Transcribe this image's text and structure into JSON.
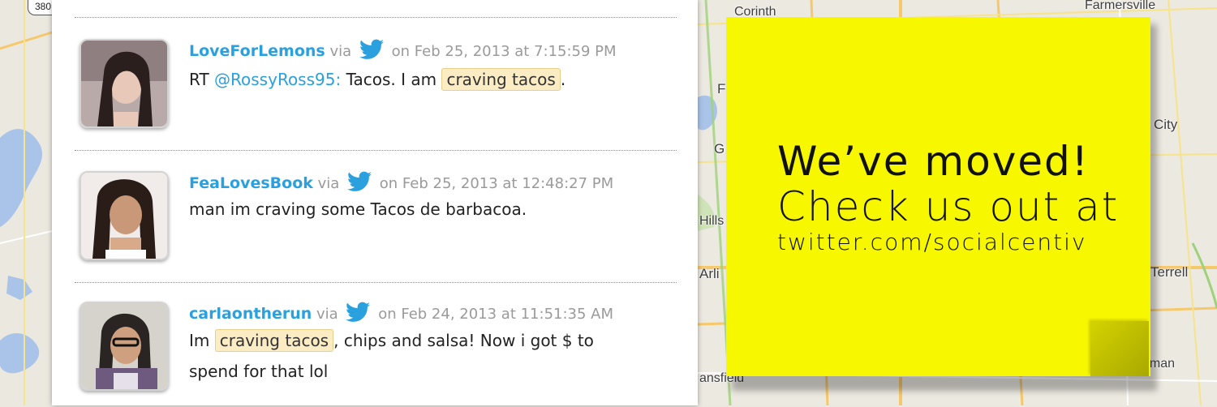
{
  "map": {
    "shield": "380",
    "labels": [
      "Corinth",
      "Farmersville",
      "City",
      "Terrell",
      "Kaufman",
      "Arli",
      "Hills",
      "G",
      "F",
      "ansfield"
    ]
  },
  "tweets": [
    {
      "username": "LoveForLemons",
      "via": "via",
      "date": "on Feb 25, 2013 at 7:15:59 PM",
      "text_rt": "RT",
      "mention": "@RossyRoss95:",
      "text_before": "Tacos. I am",
      "highlight": "craving tacos",
      "text_after": "."
    },
    {
      "username": "FeaLovesBook",
      "via": "via",
      "date": "on Feb 25, 2013 at 12:48:27 PM",
      "text": "man im craving some Tacos de barbacoa."
    },
    {
      "username": "carlaontherun",
      "via": "via",
      "date": "on Feb 24, 2013 at 11:51:35 AM",
      "text_before": "Im",
      "highlight": "craving tacos",
      "text_after": ", chips and salsa! Now i got $ to",
      "text_line2": "spend for that lol"
    }
  ],
  "note": {
    "line1": "We’ve moved!",
    "line2": "Check us out at",
    "line3": "twitter.com/socialcentiv"
  },
  "colors": {
    "accent": "#2aa0df",
    "note": "#f7f700",
    "highlight": "#fcecc4"
  }
}
